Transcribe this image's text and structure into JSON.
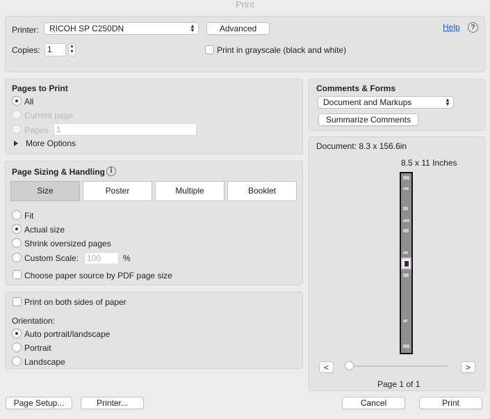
{
  "window": {
    "title": "Print"
  },
  "top": {
    "printer_label": "Printer:",
    "printer_value": "RICOH SP C250DN",
    "advanced_button": "Advanced",
    "help_link": "Help",
    "help_icon": "?",
    "copies_label": "Copies:",
    "copies_value": "1",
    "grayscale_label": "Print in grayscale (black and white)"
  },
  "pages_to_print": {
    "heading": "Pages to Print",
    "all": "All",
    "current_page": "Current page",
    "pages": "Pages",
    "pages_value": "1",
    "more_options": "More Options"
  },
  "sizing": {
    "heading": "Page Sizing & Handling",
    "info_icon": "i",
    "tabs": [
      "Size",
      "Poster",
      "Multiple",
      "Booklet"
    ],
    "fit": "Fit",
    "actual_size": "Actual size",
    "shrink": "Shrink oversized pages",
    "custom_scale": "Custom Scale:",
    "custom_scale_value": "100",
    "percent": "%",
    "paper_source": "Choose paper source by PDF page size"
  },
  "orientation": {
    "both_sides": "Print on both sides of paper",
    "heading": "Orientation:",
    "auto": "Auto portrait/landscape",
    "portrait": "Portrait",
    "landscape": "Landscape"
  },
  "comments": {
    "heading": "Comments & Forms",
    "select_value": "Document and Markups",
    "summarize_button": "Summarize Comments"
  },
  "preview": {
    "document_size": "Document: 8.3 x 156.6in",
    "paper_size": "8.5 x 11 Inches",
    "prev": "<",
    "next": ">",
    "page_info": "Page 1 of 1",
    "slider_value": 0
  },
  "footer": {
    "page_setup": "Page Setup...",
    "printer": "Printer...",
    "cancel": "Cancel",
    "print": "Print"
  }
}
